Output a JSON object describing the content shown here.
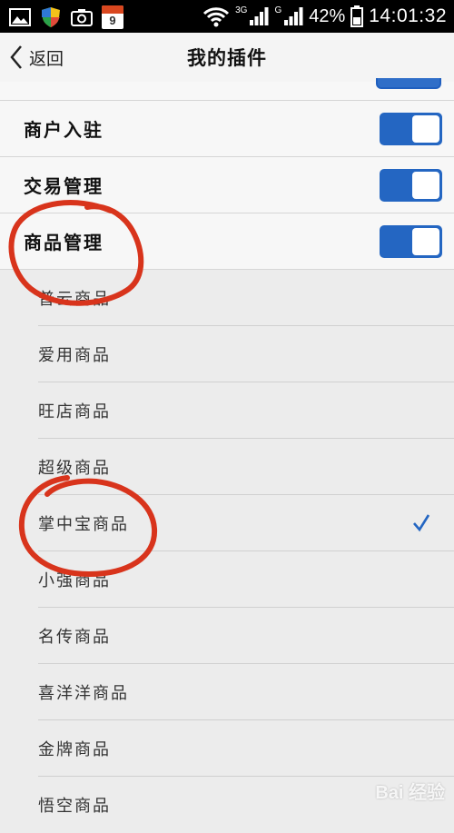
{
  "status_bar": {
    "network_a": "3G",
    "network_b": "G",
    "battery": "42%",
    "time": "14:01:32",
    "calendar_day": "9"
  },
  "header": {
    "back_label": "返回",
    "title": "我的插件"
  },
  "toggle_rows": [
    {
      "label": "商户入驻",
      "on": true
    },
    {
      "label": "交易管理",
      "on": true
    },
    {
      "label": "商品管理",
      "on": true
    }
  ],
  "sub_items": [
    {
      "label": "普云商品",
      "checked": false
    },
    {
      "label": "爱用商品",
      "checked": false
    },
    {
      "label": "旺店商品",
      "checked": false
    },
    {
      "label": "超级商品",
      "checked": false
    },
    {
      "label": "掌中宝商品",
      "checked": true
    },
    {
      "label": "小强商品",
      "checked": false
    },
    {
      "label": "名传商品",
      "checked": false
    },
    {
      "label": "喜洋洋商品",
      "checked": false
    },
    {
      "label": "金牌商品",
      "checked": false
    },
    {
      "label": "悟空商品",
      "checked": false
    }
  ],
  "colors": {
    "switch_on": "#2466c2",
    "check": "#2466c2",
    "annotation": "#d8341c"
  },
  "icons": [
    "gallery-icon",
    "shield-icon",
    "camera-icon",
    "calendar-icon",
    "wifi-icon",
    "signal-icon",
    "battery-icon",
    "chevron-left-icon",
    "checkmark-icon"
  ],
  "watermark": "Bai 经验"
}
